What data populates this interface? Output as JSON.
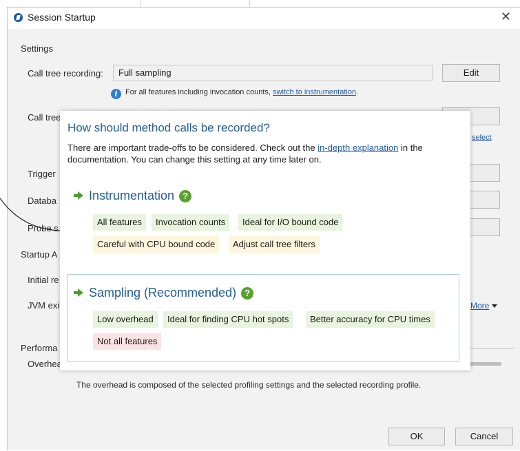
{
  "window": {
    "title": "Session Startup",
    "close_glyph": "✕"
  },
  "settings": {
    "section_label": "Settings",
    "call_tree_recording": {
      "label": "Call tree recording:",
      "value": "Full sampling",
      "edit_label": "Edit"
    },
    "hint": {
      "text": "For all features including invocation counts,",
      "link_text": "switch to instrumentation",
      "suffix": "."
    },
    "call_tree_filters": {
      "label": "Call tree",
      "edit_label": "dit",
      "link_right": "select"
    },
    "trigger": {
      "label": "Trigger",
      "edit_label": "dit"
    },
    "databases": {
      "label": "Databa",
      "edit_label": "dit"
    },
    "probes": {
      "label": "Probe s",
      "edit_label": "dit"
    }
  },
  "startup": {
    "section_label": "Startup A",
    "initial_recording": {
      "label": "Initial re"
    },
    "jvm_exit": {
      "label": "JVM exi"
    },
    "more_label": "More"
  },
  "performance": {
    "section_label": "Performa",
    "overhead_label": "Overhead:",
    "overhead_fraction": 0.27,
    "note": "The overhead is composed of the selected profiling settings and the selected recording profile."
  },
  "buttons": {
    "ok": "OK",
    "cancel": "Cancel"
  },
  "popup": {
    "title": "How should method calls be recorded?",
    "description_before_link": "There are important trade-offs to be considered. Check out the",
    "description_link": "in-depth explanation",
    "description_after_link": "in the documentation. You can change this setting at any time later on.",
    "instrumentation": {
      "heading": "Instrumentation",
      "help_glyph": "?",
      "pros": [
        "All features",
        "Invocation counts",
        "Ideal for I/O bound code"
      ],
      "warnings": [
        "Careful with CPU bound code",
        "Adjust call tree filters"
      ]
    },
    "sampling": {
      "heading": "Sampling (Recommended)",
      "help_glyph": "?",
      "pros": [
        "Low overhead",
        "Ideal for finding CPU hot spots",
        "Better accuracy for CPU times"
      ],
      "cons": [
        "Not all features"
      ]
    }
  },
  "colors": {
    "accent_blue": "#1f5d98",
    "link_blue": "#1f57a8",
    "pro_bg": "#e8f4de",
    "warn_bg": "#fdf5dc",
    "con_bg": "#fbe3e3",
    "help_green": "#5aa02c"
  }
}
